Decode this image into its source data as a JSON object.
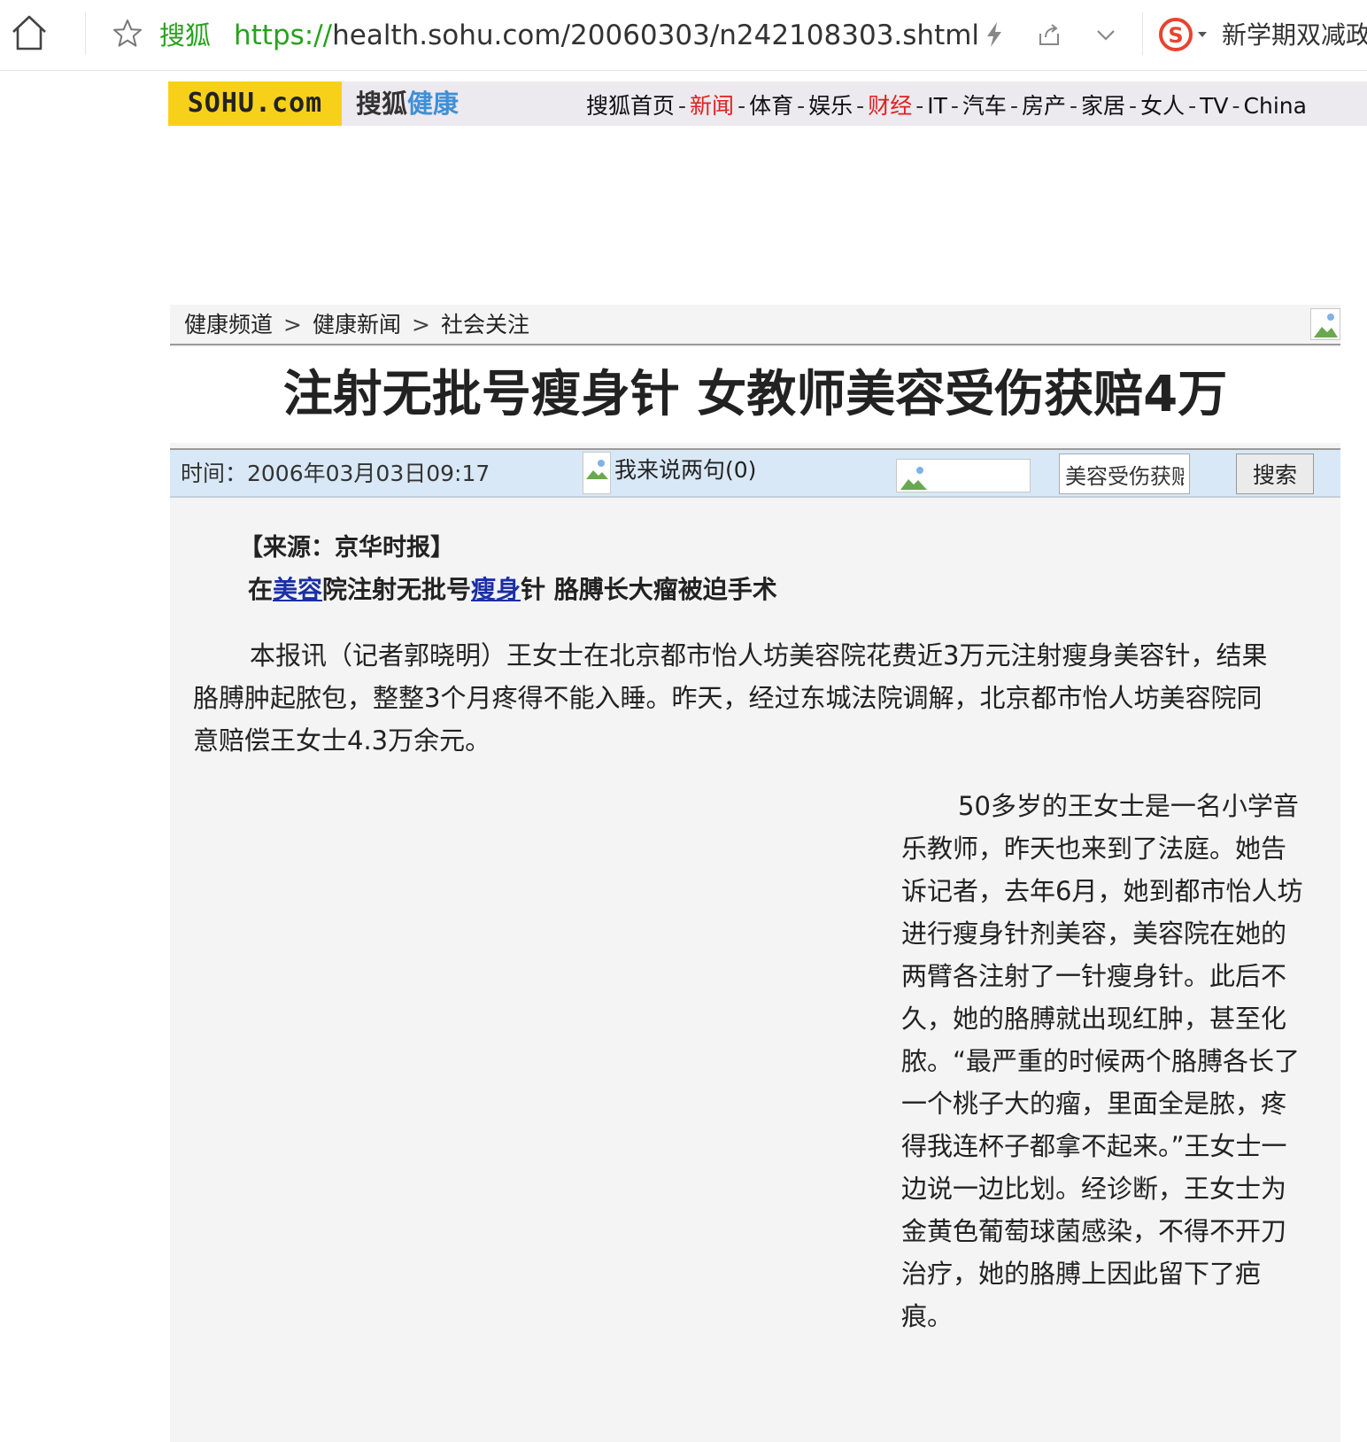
{
  "browser": {
    "site_label": "搜狐",
    "url_scheme": "https://",
    "url_rest": "health.sohu.com/20060303/n242108303.shtml",
    "ticker": "新学期双减政"
  },
  "header": {
    "logo_text": "SOHU.com",
    "channel_a": "搜狐",
    "channel_b": "健康",
    "nav": [
      "搜狐首页",
      "新闻",
      "体育",
      "娱乐",
      "财经",
      "IT",
      "汽车",
      "房产",
      "家居",
      "女人",
      "TV",
      "China"
    ],
    "nav_separator": "-",
    "accent_red": "#e02020"
  },
  "breadcrumb": {
    "items": [
      "健康频道",
      "健康新闻",
      "社会关注"
    ],
    "separator": ">"
  },
  "article": {
    "headline": "注射无批号瘦身针 女教师美容受伤获赔4万",
    "time": "时间：2006年03月03日09:17",
    "comment_label": "我来说两句(0)",
    "search_value": "美容受伤获赔",
    "search_button": "搜索",
    "source": "【来源：京华时报】",
    "subtitle_parts": [
      "在",
      "美容",
      "院注射无批号",
      "瘦身",
      "针 胳膊长大瘤被迫手术"
    ],
    "paragraph1": "本报讯（记者郭晓明）王女士在北京都市怡人坊美容院花费近3万元注射瘦身美容针，结果胳膊肿起脓包，整整3个月疼得不能入睡。昨天，经过东城法院调解，北京都市怡人坊美容院同意赔偿王女士4.3万余元。",
    "paragraph2": "50多岁的王女士是一名小学音乐教师，昨天也来到了法庭。她告诉记者，去年6月，她到都市怡人坊进行瘦身针剂美容，美容院在她的两臂各注射了一针瘦身针。此后不久，她的胳膊就出现红肿，甚至化脓。“最严重的时候两个胳膊各长了一个桃子大的瘤，里面全是脓，疼得我连杯子都拿不起来。”王女士一边说一边比划。经诊断，王女士为金黄色葡萄球菌感染，不得不开刀治疗，她的胳膊上因此留下了疤痕。"
  }
}
